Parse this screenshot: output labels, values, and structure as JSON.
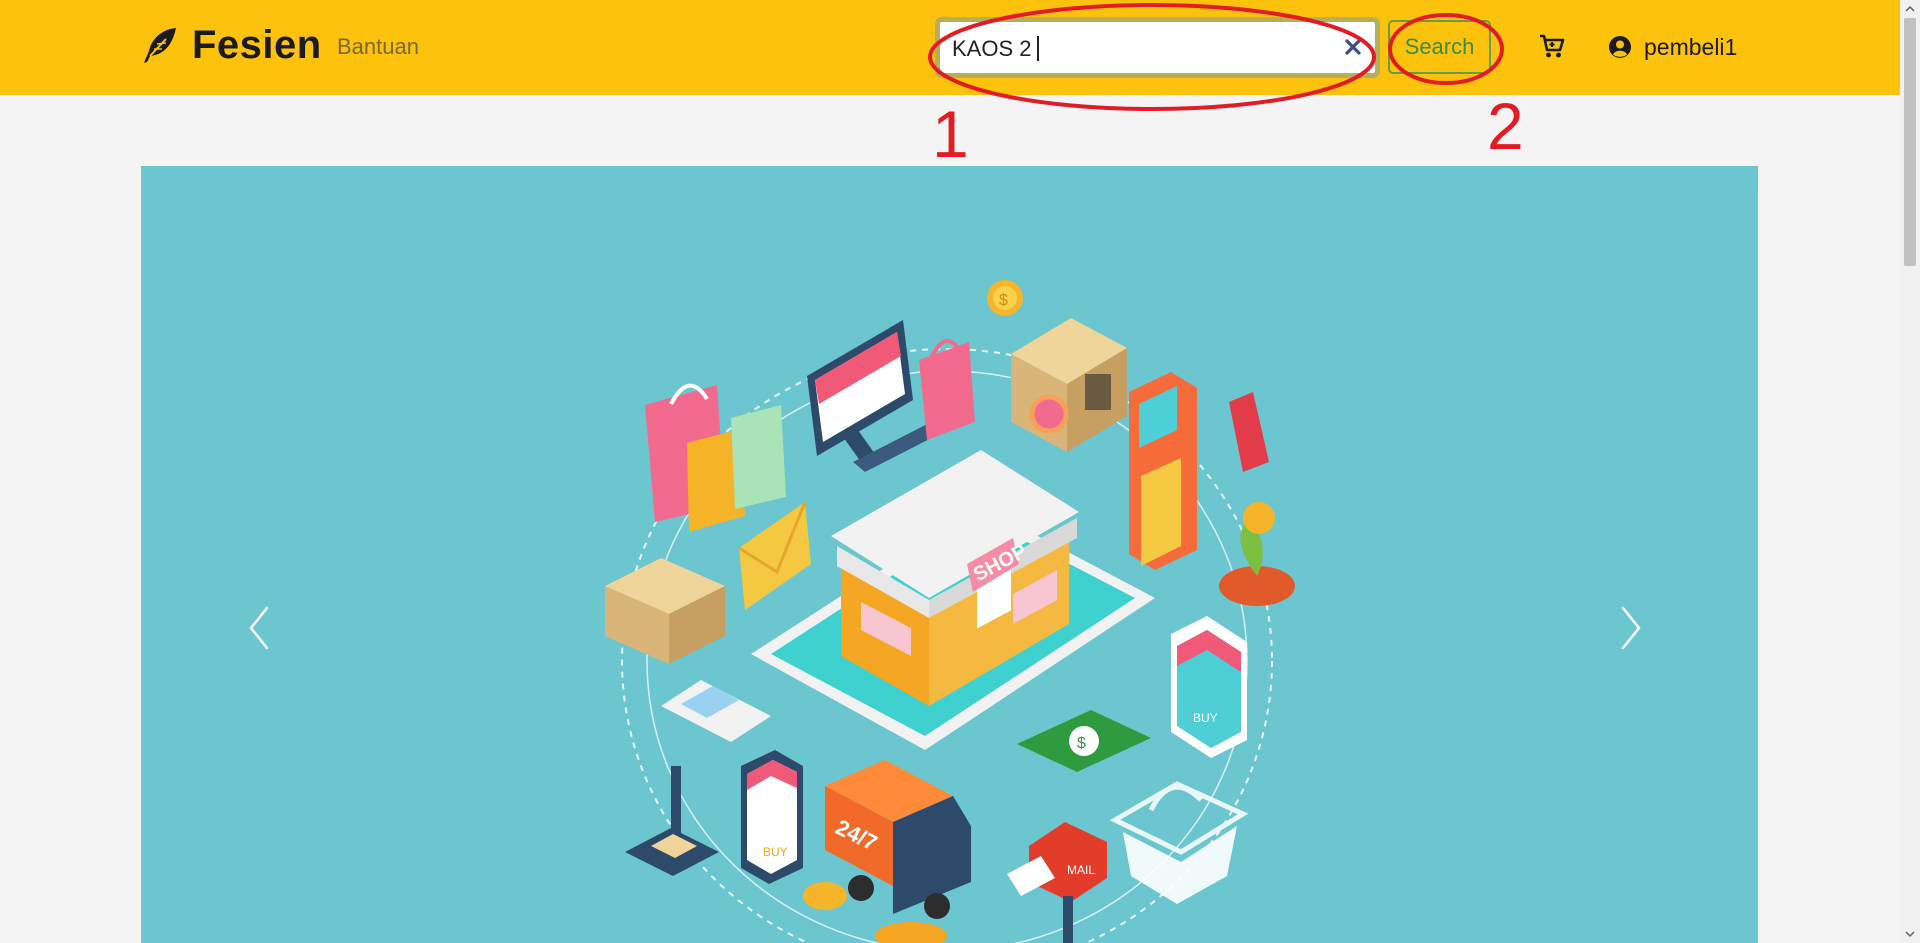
{
  "header": {
    "brand_name": "Fesien",
    "brand_icon": "feather-icon",
    "nav_link": "Bantuan",
    "search": {
      "value": "KAOS 2",
      "placeholder": ""
    },
    "search_button": "Search",
    "cart_icon": "cart-icon",
    "user_icon": "user-circle-icon",
    "username": "pembeli1"
  },
  "annotations": {
    "step1": "1",
    "step2": "2"
  },
  "carousel": {
    "prev_icon": "chevron-left-icon",
    "next_icon": "chevron-right-icon",
    "shop_sign": "SHOP",
    "truck_label": "24/7",
    "mail_label": "MAIL",
    "phone_buy_label": "BUY",
    "tablet_buy_label": "BUY"
  },
  "colors": {
    "navbar": "#fdc20b",
    "carousel_bg": "#6cc6d0",
    "search_button_text": "#3e8a3e",
    "annotation": "#e31c23"
  }
}
